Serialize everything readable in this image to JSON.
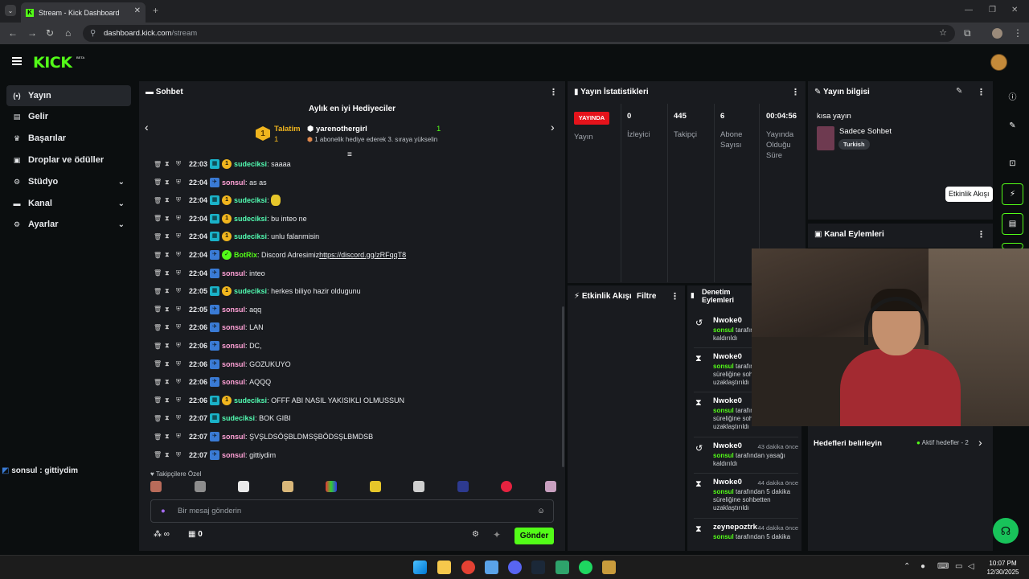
{
  "browser": {
    "tab_title": "Stream - Kick Dashboard",
    "favicon_letter": "K",
    "url_host": "dashboard.kick.com",
    "url_path": "/stream"
  },
  "header": {
    "logo": "KICK",
    "beta": "BETA"
  },
  "sidebar": {
    "items": [
      {
        "label": "Yayın",
        "icon": "broadcast-icon",
        "glyph": "(•)"
      },
      {
        "label": "Gelir",
        "icon": "revenue-icon",
        "glyph": "▤"
      },
      {
        "label": "Başarılar",
        "icon": "trophy-icon",
        "glyph": "♛"
      },
      {
        "label": "Droplar ve ödüller",
        "icon": "gift-icon",
        "glyph": "▣"
      },
      {
        "label": "Stüdyo",
        "icon": "studio-icon",
        "glyph": "⚙"
      },
      {
        "label": "Kanal",
        "icon": "channel-icon",
        "glyph": "▬"
      },
      {
        "label": "Ayarlar",
        "icon": "settings-icon",
        "glyph": "⚙"
      }
    ],
    "chat_preview": "sonsul : gittiydim"
  },
  "chat": {
    "title": "Sohbet",
    "gift_header": "Aylık en iyi Hediyeciler",
    "top_gifter": {
      "rank": "1",
      "name": "Talatim",
      "count": "1"
    },
    "second_gifter": {
      "name": "yarenothergirl",
      "count": "1",
      "note": "1 abonelik hediye ederek 3. sıraya yükselin"
    },
    "messages": [
      {
        "time": "22:03",
        "user": "sudeciksi",
        "text": "saaaa",
        "color": "u-lime",
        "badges": [
          "sub",
          "gift"
        ]
      },
      {
        "time": "22:04",
        "user": "sonsul",
        "text": "as as",
        "color": "u-pink",
        "badges": [
          "vip"
        ]
      },
      {
        "time": "22:04",
        "user": "sudeciksi",
        "text": "",
        "color": "u-lime",
        "badges": [
          "sub",
          "gift"
        ],
        "emote": true
      },
      {
        "time": "22:04",
        "user": "sudeciksi",
        "text": "bu inteo ne",
        "color": "u-lime",
        "badges": [
          "sub",
          "gift"
        ]
      },
      {
        "time": "22:04",
        "user": "sudeciksi",
        "text": "unlu falanmisin",
        "color": "u-lime",
        "badges": [
          "sub",
          "gift"
        ]
      },
      {
        "time": "22:04",
        "user": "BotRix",
        "text": "Discord Adresimiz ",
        "link": "https://discord.gg/zRFqqT8",
        "color": "u-green",
        "badges": [
          "vip",
          "bot"
        ]
      },
      {
        "time": "22:04",
        "user": "sonsul",
        "text": "inteo",
        "color": "u-pink",
        "badges": [
          "vip"
        ]
      },
      {
        "time": "22:05",
        "user": "sudeciksi",
        "text": "herkes biliyo hazir oldugunu",
        "color": "u-lime",
        "badges": [
          "sub",
          "gift"
        ]
      },
      {
        "time": "22:05",
        "user": "sonsul",
        "text": "aqq",
        "color": "u-pink",
        "badges": [
          "vip"
        ]
      },
      {
        "time": "22:06",
        "user": "sonsul",
        "text": "LAN",
        "color": "u-pink",
        "badges": [
          "vip"
        ]
      },
      {
        "time": "22:06",
        "user": "sonsul",
        "text": "DC,",
        "color": "u-pink",
        "badges": [
          "vip"
        ]
      },
      {
        "time": "22:06",
        "user": "sonsul",
        "text": "GOZUKUYO",
        "color": "u-pink",
        "badges": [
          "vip"
        ]
      },
      {
        "time": "22:06",
        "user": "sonsul",
        "text": "AQQQ",
        "color": "u-pink",
        "badges": [
          "vip"
        ]
      },
      {
        "time": "22:06",
        "user": "sudeciksi",
        "text": "OFFF ABI NASIL YAKISIKLI OLMUSSUN",
        "color": "u-lime",
        "badges": [
          "sub",
          "gift"
        ]
      },
      {
        "time": "22:07",
        "user": "sudeciksi",
        "text": "BOK GIBI",
        "color": "u-lime",
        "badges": [
          "sub"
        ]
      },
      {
        "time": "22:07",
        "user": "sonsul",
        "text": "ŞVŞLDSÖŞBLDMSŞBÖDSŞLBMDSB",
        "color": "u-pink",
        "badges": [
          "vip"
        ]
      },
      {
        "time": "22:07",
        "user": "sonsul",
        "text": "gittiydim",
        "color": "u-pink",
        "badges": [
          "vip"
        ]
      }
    ],
    "emote_label": "Takipçilere Özel",
    "input_placeholder": "Bir mesaj gönderin",
    "points": "∞",
    "store_count": "0",
    "send_label": "Gönder"
  },
  "stats": {
    "title": "Yayın İstatistikleri",
    "live_label": "YAYINDA",
    "stream_label": "Yayın",
    "items": [
      {
        "value": "0",
        "label": "İzleyici"
      },
      {
        "value": "445",
        "label": "Takipçi"
      },
      {
        "value": "6",
        "label": "Abone Sayısı"
      },
      {
        "value": "00:04:56",
        "label": "Yayında Olduğu Süre"
      }
    ]
  },
  "info": {
    "title": "Yayın bilgisi",
    "stream_title": "kısa yayın",
    "category": "Sadece Sohbet",
    "language": "Turkish"
  },
  "channel_actions": {
    "title": "Kanal Eylemleri"
  },
  "goals": {
    "title": "Hedefleri belirleyin",
    "active": "Aktif hedefler - 2"
  },
  "activity": {
    "title": "Etkinlik Akışı",
    "filter": "Filtre"
  },
  "moderation": {
    "title": "Denetim Eylemleri",
    "rows": [
      {
        "user": "Nwoke0",
        "icon": "↺",
        "ago": "",
        "text_user": "sonsul",
        "text": " tarafından yasağı kaldırıldı"
      },
      {
        "user": "Nwoke0",
        "icon": "⧗",
        "ago": "",
        "text_user": "sonsul",
        "text": " tarafından 5 dakika süreliğine sohbetten uzaklaştırıldı"
      },
      {
        "user": "Nwoke0",
        "icon": "⧗",
        "ago": "",
        "text_user": "sonsul",
        "text": " tarafından 5 dakika süreliğine sohbetten uzaklaştırıldı"
      },
      {
        "user": "Nwoke0",
        "icon": "↺",
        "ago": "43 dakika önce",
        "text_user": "sonsul",
        "text": " tarafından yasağı kaldırıldı"
      },
      {
        "user": "Nwoke0",
        "icon": "⧗",
        "ago": "44 dakika önce",
        "text_user": "sonsul",
        "text": " tarafından 5 dakika süreliğine sohbetten uzaklaştırıldı"
      },
      {
        "user": "zeynepoztrk",
        "icon": "⧗",
        "ago": "44 dakika önce",
        "text_user": "sonsul",
        "text": " tarafından 5 dakika"
      }
    ]
  },
  "rail": {
    "tooltip": "Etkinlik Akışı"
  },
  "taskbar": {
    "time": "10:07 PM",
    "date": "12/30/2025"
  }
}
